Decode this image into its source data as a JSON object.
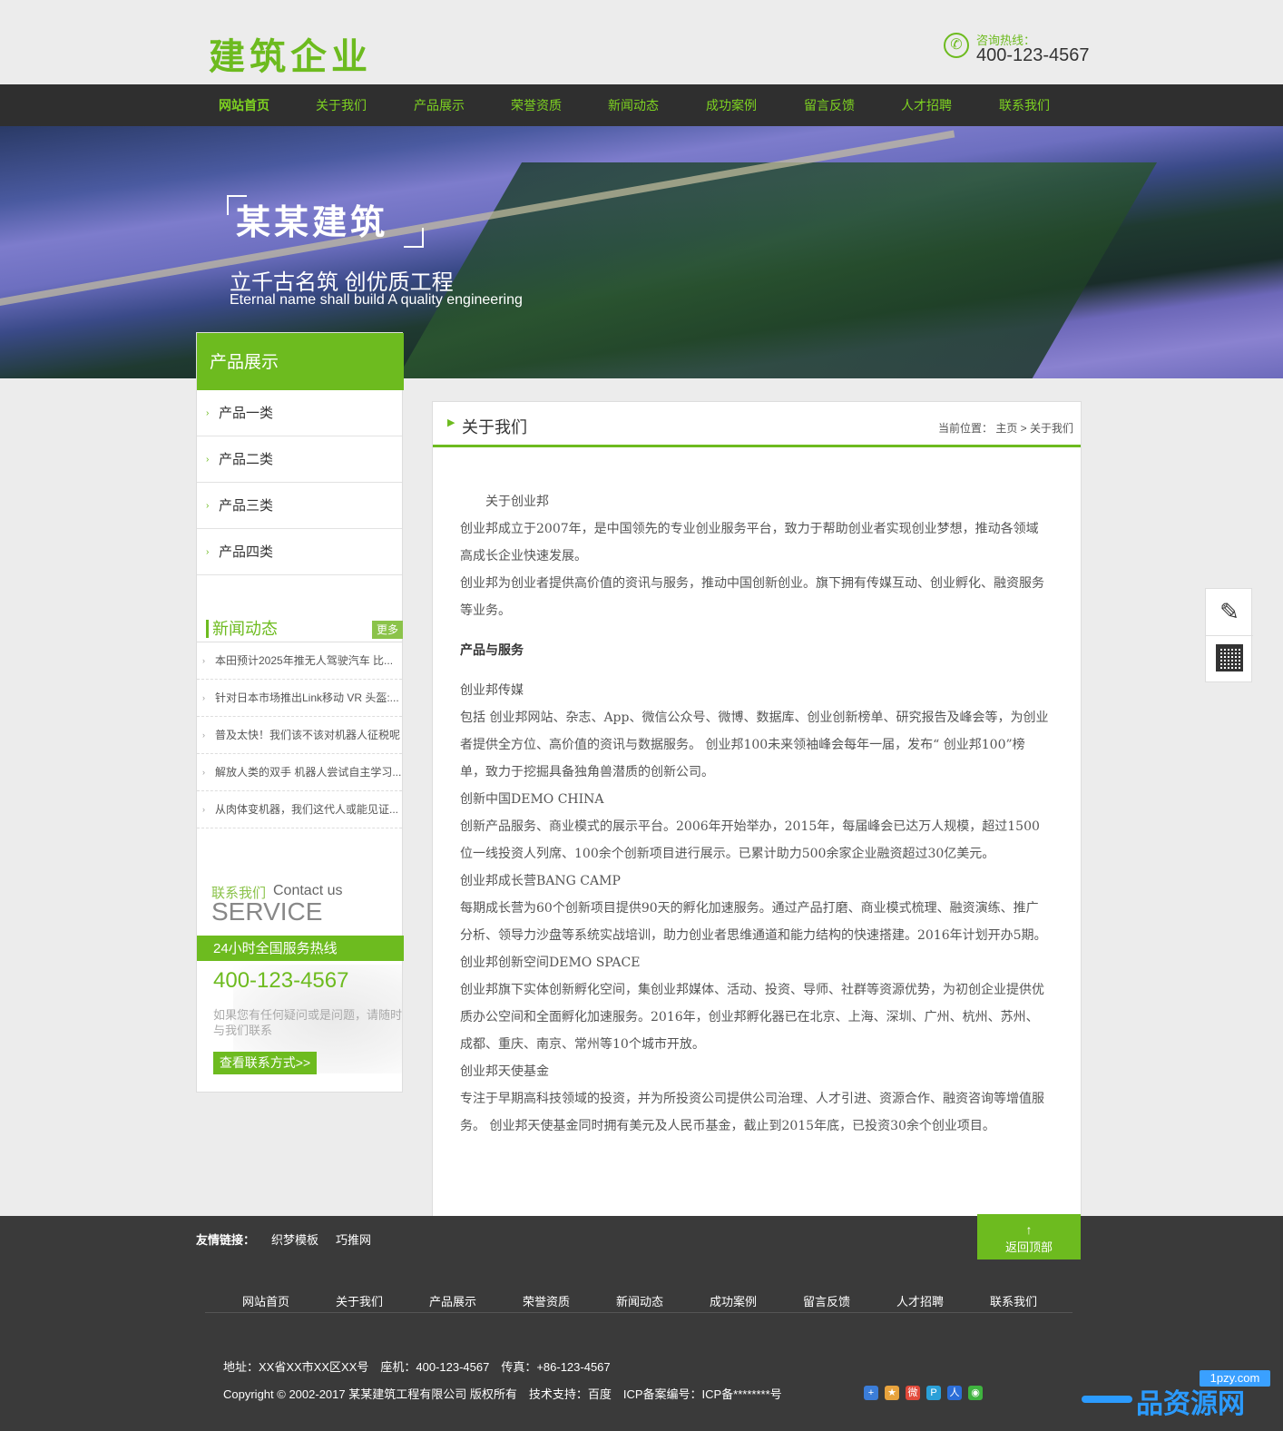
{
  "header": {
    "logo": "建筑企业",
    "hotline_label": "咨询热线：",
    "hotline_number": "400-123-4567"
  },
  "nav": [
    "网站首页",
    "关于我们",
    "产品展示",
    "荣誉资质",
    "新闻动态",
    "成功案例",
    "留言反馈",
    "人才招聘",
    "联系我们"
  ],
  "banner": {
    "brand": "某某建筑",
    "slogan": "立千古名筑 创优质工程",
    "slogan_en": "Eternal name shall build A quality engineering"
  },
  "sidebar": {
    "title": "产品展示",
    "categories": [
      "产品一类",
      "产品二类",
      "产品三类",
      "产品四类"
    ],
    "news_title": "新闻动态",
    "news_more": "更多",
    "news": [
      "本田预计2025年推无人驾驶汽车 比...",
      "针对日本市场推出Link移动 VR 头盔:...",
      "普及太快！我们该不该对机器人征税呢",
      "解放人类的双手 机器人尝试自主学习...",
      "从肉体变机器，我们这代人或能见证..."
    ],
    "contact_cn": "联系我们",
    "contact_en": "Contact us",
    "service": "SERVICE",
    "hotline_title": "24小时全国服务热线",
    "phone": "400-123-4567",
    "note": "如果您有任何疑问或是问题，请随时与我们联系",
    "button": "查看联系方式>>"
  },
  "content": {
    "title": "关于我们",
    "breadcrumb": "当前位置： 主页 > 关于我们",
    "p1": "关于创业邦",
    "p2": "创业邦成立于2007年，是中国领先的专业创业服务平台，致力于帮助创业者实现创业梦想，推动各领域高成长企业快速发展。",
    "p3": "创业邦为创业者提供高价值的资讯与服务，推动中国创新创业。旗下拥有传媒互动、创业孵化、融资服务等业务。",
    "h1": "产品与服务",
    "p4": "创业邦传媒",
    "p5": "包括 创业邦网站、杂志、App、微信公众号、微博、数据库、创业创新榜单、研究报告及峰会等，为创业者提供全方位、高价值的资讯与数据服务。 创业邦100未来领袖峰会每年一届，发布“ 创业邦100”榜单，致力于挖掘具备独角兽潜质的创新公司。",
    "p6": "创新中国DEMO CHINA",
    "p7": "创新产品服务、商业模式的展示平台。2006年开始举办，2015年，每届峰会已达万人规模，超过1500位一线投资人列席、100余个创新项目进行展示。已累计助力500余家企业融资超过30亿美元。",
    "p8": "创业邦成长营BANG CAMP",
    "p9": "每期成长营为60个创新项目提供90天的孵化加速服务。通过产品打磨、商业模式梳理、融资演练、推广分析、领导力沙盘等系统实战培训，助力创业者思维通道和能力结构的快速搭建。2016年计划开办5期。",
    "p10": "创业邦创新空间DEMO SPACE",
    "p11": "创业邦旗下实体创新孵化空间，集创业邦媒体、活动、投资、导师、社群等资源优势，为初创企业提供优质办公空间和全面孵化加速服务。2016年，创业邦孵化器已在北京、上海、深圳、广州、杭州、苏州、成都、重庆、南京、常州等10个城市开放。",
    "p12": "创业邦天使基金",
    "p13": "专注于早期高科技领域的投资，并为所投资公司提供公司治理、人才引进、资源合作、融资咨询等增值服务。 创业邦天使基金同时拥有美元及人民币基金，截止到2015年底，已投资30余个创业项目。"
  },
  "links": {
    "label": "友情链接：",
    "items": [
      "织梦模板",
      "巧推网"
    ],
    "back_top": "返回顶部"
  },
  "footer": {
    "nav": [
      "网站首页",
      "关于我们",
      "产品展示",
      "荣誉资质",
      "新闻动态",
      "成功案例",
      "留言反馈",
      "人才招聘",
      "联系我们"
    ],
    "address": "地址：XX省XX市XX区XX号　座机：400-123-4567　传真：+86-123-4567",
    "copyright": "Copyright © 2002-2017 某某建筑工程有限公司 版权所有　技术支持：百度　ICP备案编号：ICP备********号"
  },
  "watermark": {
    "url": "1pzy.com",
    "text": "品资源网"
  },
  "colors": {
    "accent": "#6dbb1f",
    "nav_bg": "#2f2f2f",
    "footer_bg": "#3a3a3a"
  }
}
